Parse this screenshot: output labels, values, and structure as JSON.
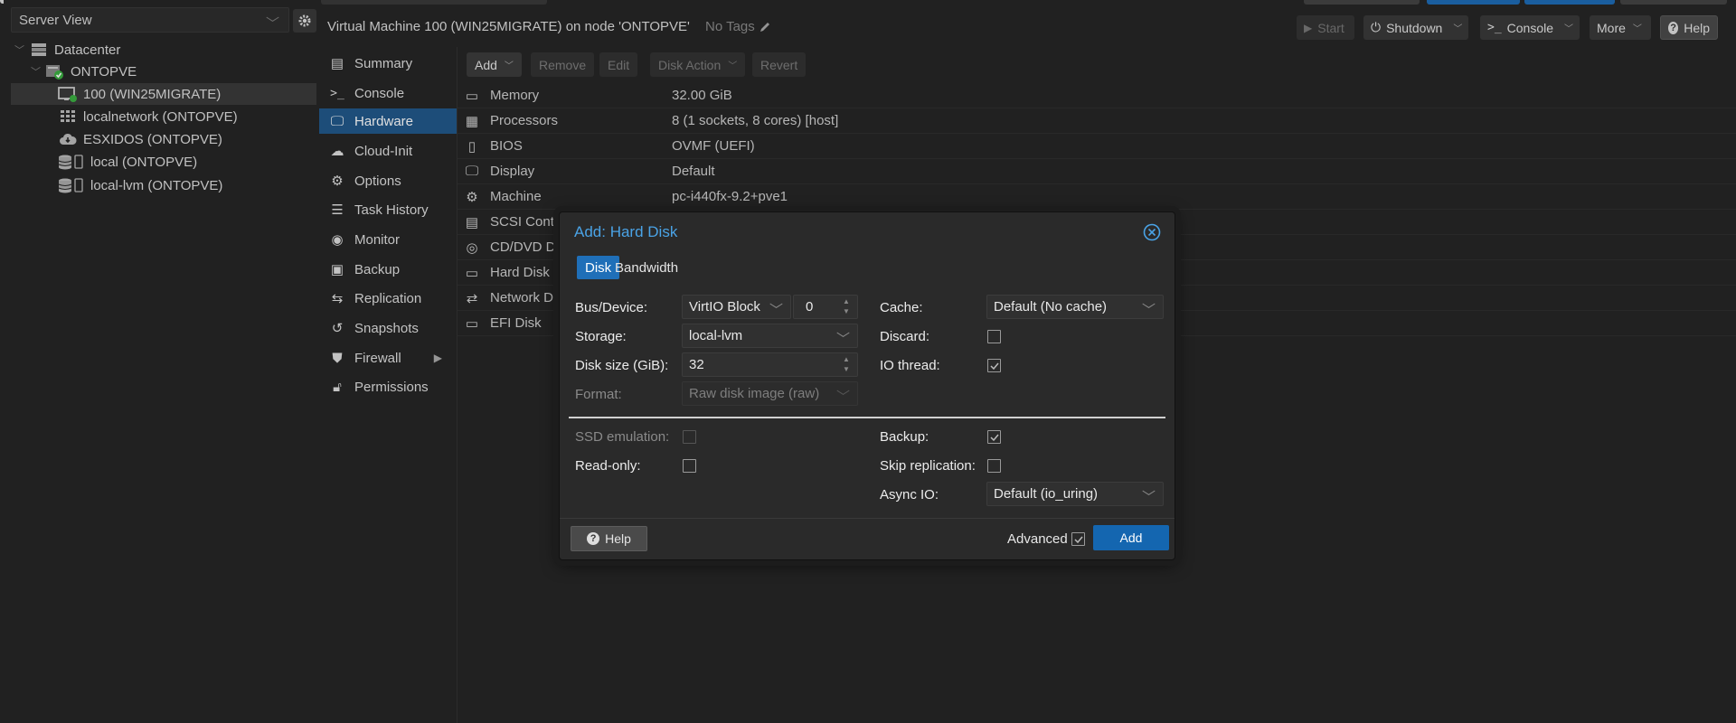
{
  "tree": {
    "view_selector": "Server View",
    "items": [
      {
        "label": "Datacenter"
      },
      {
        "label": "ONTOPVE"
      },
      {
        "label": "100 (WIN25MIGRATE)"
      },
      {
        "label": "localnetwork (ONTOPVE)"
      },
      {
        "label": "ESXIDOS (ONTOPVE)"
      },
      {
        "label": "local (ONTOPVE)"
      },
      {
        "label": "local-lvm (ONTOPVE)"
      }
    ]
  },
  "header": {
    "title": "Virtual Machine 100 (WIN25MIGRATE) on node 'ONTOPVE'",
    "tags": "No Tags",
    "buttons": {
      "start": "Start",
      "shutdown": "Shutdown",
      "console": "Console",
      "more": "More",
      "help": "Help"
    }
  },
  "vm_menu": {
    "items": [
      {
        "label": "Summary"
      },
      {
        "label": "Console"
      },
      {
        "label": "Hardware"
      },
      {
        "label": "Cloud-Init"
      },
      {
        "label": "Options"
      },
      {
        "label": "Task History"
      },
      {
        "label": "Monitor"
      },
      {
        "label": "Backup"
      },
      {
        "label": "Replication"
      },
      {
        "label": "Snapshots"
      },
      {
        "label": "Firewall"
      },
      {
        "label": "Permissions"
      }
    ],
    "selected": "Hardware"
  },
  "toolbar": {
    "add": "Add",
    "remove": "Remove",
    "edit": "Edit",
    "disk_action": "Disk Action",
    "revert": "Revert"
  },
  "hardware": [
    {
      "name": "Memory",
      "value": "32.00 GiB"
    },
    {
      "name": "Processors",
      "value": "8 (1 sockets, 8 cores) [host]"
    },
    {
      "name": "BIOS",
      "value": "OVMF (UEFI)"
    },
    {
      "name": "Display",
      "value": "Default"
    },
    {
      "name": "Machine",
      "value": "pc-i440fx-9.2+pve1"
    },
    {
      "name": "SCSI Contro",
      "value": ""
    },
    {
      "name": "CD/DVD Driv",
      "value": ""
    },
    {
      "name": "Hard Disk (s",
      "value": ""
    },
    {
      "name": "Network Dev",
      "value": ""
    },
    {
      "name": "EFI Disk",
      "value": ""
    }
  ],
  "dialog": {
    "title": "Add: Hard Disk",
    "tabs": [
      "Disk",
      "Bandwidth"
    ],
    "active_tab": "Disk",
    "fields": {
      "bus_device_label": "Bus/Device:",
      "bus_value": "VirtIO Block",
      "device_number": "0",
      "storage_label": "Storage:",
      "storage_value": "local-lvm",
      "disk_size_label": "Disk size (GiB):",
      "disk_size_value": "32",
      "format_label": "Format:",
      "format_value": "Raw disk image (raw)",
      "cache_label": "Cache:",
      "cache_value": "Default (No cache)",
      "discard_label": "Discard:",
      "discard_checked": false,
      "io_thread_label": "IO thread:",
      "io_thread_checked": true,
      "ssd_label": "SSD emulation:",
      "ssd_checked": false,
      "readonly_label": "Read-only:",
      "readonly_checked": false,
      "backup_label": "Backup:",
      "backup_checked": true,
      "skip_replication_label": "Skip replication:",
      "skip_replication_checked": false,
      "async_io_label": "Async IO:",
      "async_io_value": "Default (io_uring)"
    },
    "footer": {
      "help": "Help",
      "advanced": "Advanced",
      "advanced_checked": true,
      "add": "Add"
    }
  },
  "colors": {
    "accent": "#1f6fb8",
    "selected_menu": "#21588a",
    "dialog_title": "#4aa3e6",
    "status_ok": "#3cb043"
  }
}
